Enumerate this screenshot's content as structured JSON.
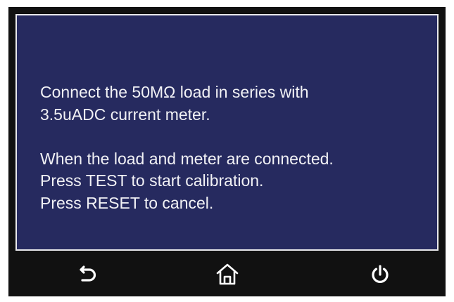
{
  "panel": {
    "lines": [
      "Connect the 50MΩ load in series with",
      "3.5uADC current meter.",
      "When the load and meter are connected.",
      "Press TEST to start calibration.",
      "Press RESET to cancel."
    ]
  },
  "footer": {
    "buttons": [
      {
        "icon": "back-arrow-icon"
      },
      {
        "icon": "home-icon"
      },
      {
        "icon": "power-icon"
      }
    ]
  },
  "colors": {
    "panel_background": "#262a5f",
    "panel_border": "#e9e9ec",
    "screen_background": "#111111",
    "text": "#f1f1f5",
    "icon": "#ffffff"
  }
}
